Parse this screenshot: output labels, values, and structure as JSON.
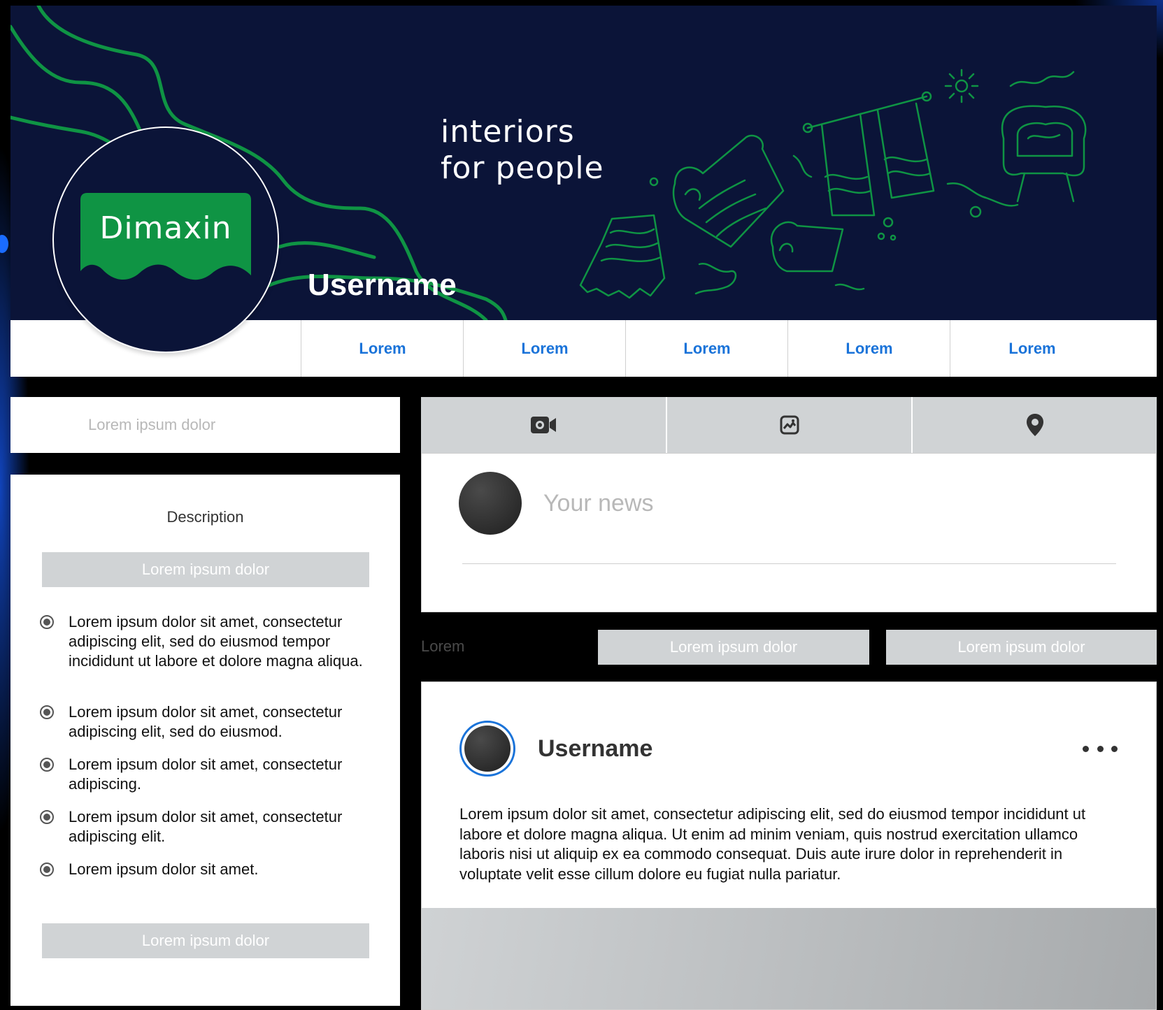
{
  "banner": {
    "tagline_line1": "interiors",
    "tagline_line2": "for people",
    "username": "Username",
    "logo_text": "Dimaxin"
  },
  "colors": {
    "banner_bg": "#0b1438",
    "brand_green": "#0f9444",
    "link_blue": "#1a73d9",
    "gray_button": "#d0d3d5"
  },
  "nav": {
    "tabs": [
      "Lorem",
      "Lorem",
      "Lorem",
      "Lorem",
      "Lorem"
    ]
  },
  "sidebar": {
    "search_placeholder": "Lorem ipsum dolor",
    "description_title": "Description",
    "top_button": "Lorem ipsum dolor",
    "items": [
      "Lorem ipsum dolor sit amet, consectetur adipiscing elit, sed do eiusmod tempor incididunt ut labore et dolore magna aliqua.",
      "Lorem ipsum dolor sit amet, consectetur adipiscing elit, sed do eiusmod.",
      "Lorem ipsum dolor sit amet, consectetur adipiscing.",
      "Lorem ipsum dolor sit amet, consectetur adipiscing elit.",
      "Lorem ipsum dolor sit amet."
    ],
    "bottom_button": "Lorem ipsum dolor"
  },
  "media_bar": {
    "icons": [
      "video-camera-icon",
      "image-icon",
      "location-pin-icon"
    ]
  },
  "composer": {
    "placeholder": "Your news"
  },
  "filters": {
    "label": "Lorem",
    "button1": "Lorem ipsum dolor",
    "button2": "Lorem ipsum dolor"
  },
  "post": {
    "username": "Username",
    "text": "Lorem ipsum dolor sit amet, consectetur adipiscing elit, sed do eiusmod tempor incididunt ut labore et dolore magna aliqua. Ut enim ad minim veniam, quis nostrud exercitation ullamco laboris nisi ut aliquip ex ea commodo consequat. Duis aute irure dolor in reprehenderit in voluptate velit esse cillum dolore eu fugiat nulla pariatur."
  }
}
